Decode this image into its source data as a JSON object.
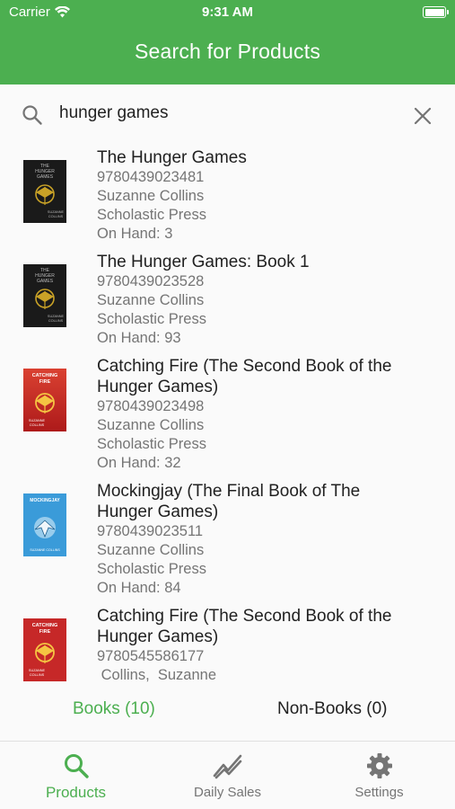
{
  "status": {
    "carrier": "Carrier",
    "time": "9:31 AM"
  },
  "appbar": {
    "title": "Search for Products"
  },
  "search": {
    "value": "hunger games",
    "icon": "search-icon",
    "clear_icon": "close-icon"
  },
  "products": [
    {
      "title": "The Hunger Games",
      "isbn": "9780439023481",
      "author": "Suzanne Collins",
      "publisher": "Scholastic Press",
      "on_hand": "On Hand: 3",
      "cover": "hunger-games-cover"
    },
    {
      "title": "The Hunger Games: Book 1",
      "isbn": "9780439023528",
      "author": "Suzanne Collins",
      "publisher": "Scholastic Press",
      "on_hand": "On Hand: 93",
      "cover": "hunger-games-cover"
    },
    {
      "title_line1": "Catching Fire (The Second Book of the",
      "title_line2": "Hunger Games)",
      "isbn": "9780439023498",
      "author": "Suzanne Collins",
      "publisher": "Scholastic Press",
      "on_hand": "On Hand: 32",
      "cover": "catching-fire-cover"
    },
    {
      "title_line1": "Mockingjay (The Final Book of The",
      "title_line2": "Hunger Games)",
      "isbn": "9780439023511",
      "author": "Suzanne Collins",
      "publisher": "Scholastic Press",
      "on_hand": "On Hand: 84",
      "cover": "mockingjay-cover"
    },
    {
      "title_line1": "Catching Fire (The Second Book of the",
      "title_line2": "Hunger Games)",
      "isbn": "9780545586177",
      "author": " Collins,  Suzanne",
      "cover": "catching-fire-cover"
    }
  ],
  "segments": {
    "books": "Books (10)",
    "nonbooks": "Non-Books (0)"
  },
  "bottom_nav": [
    {
      "label": "Products",
      "icon": "search-icon",
      "active": true
    },
    {
      "label": "Daily Sales",
      "icon": "trending-icon",
      "active": false
    },
    {
      "label": "Settings",
      "icon": "gear-icon",
      "active": false
    }
  ],
  "colors": {
    "primary": "#4caf50",
    "text": "#212121",
    "secondary_text": "#757575",
    "catching_fire_red": "#c62828",
    "mockingjay_blue": "#3a9bd9"
  },
  "cover_lettering": {
    "hunger_games": [
      "THE",
      "HUNGER",
      "GAMES",
      "SUZANNE",
      "COLLINS"
    ],
    "catching_fire": [
      "CATCHING",
      "FIRE",
      "SUZANNE",
      "COLLINS"
    ],
    "mockingjay": [
      "MOCKINGJAY",
      "SUZANNE COLLINS"
    ]
  }
}
